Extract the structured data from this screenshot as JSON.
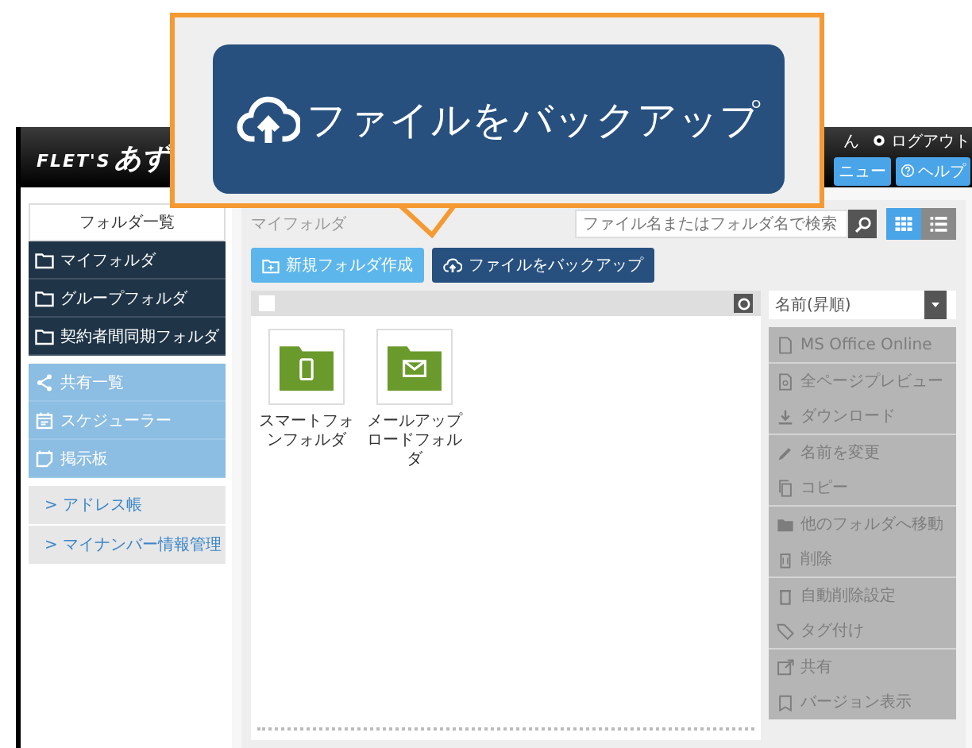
{
  "header": {
    "logo_latin": "FLET'S",
    "logo_kana": "あず",
    "user_suffix": "ん",
    "logout": "ログアウト",
    "menu_button": "ニュー",
    "help_button": "ヘルプ"
  },
  "callout": {
    "label": "ファイルをバックアップ"
  },
  "sidebar": {
    "title": "フォルダ一覧",
    "folders": [
      "マイフォルダ",
      "グループフォルダ",
      "契約者間同期フォルダ"
    ],
    "tools": [
      {
        "label": "共有一覧",
        "kind": "share"
      },
      {
        "label": "スケジューラー",
        "kind": "calendar"
      },
      {
        "label": "掲示板",
        "kind": "board"
      }
    ],
    "links": [
      "> アドレス帳",
      "> マイナンバー情報管理"
    ]
  },
  "breadcrumb": "マイフォルダ",
  "toolbar": {
    "new_folder": "新規フォルダ作成",
    "backup": "ファイルをバックアップ",
    "search": {
      "placeholder": "ファイル名またはフォルダ名で検索"
    },
    "views": [
      {
        "kind": "grid",
        "selected": true
      },
      {
        "kind": "list",
        "selected": false
      }
    ]
  },
  "file_list": {
    "select_all": {
      "checked": false
    },
    "sort": "名前(昇順)",
    "items": [
      {
        "name": "スマートフォンフォルダ",
        "kind": "phone"
      },
      {
        "name": "メールアップロードフォルダ",
        "kind": "mail"
      }
    ]
  },
  "actions": [
    {
      "items": [
        {
          "label": "MS Office Online",
          "kind": "office",
          "disabled": true
        }
      ]
    },
    {
      "items": [
        {
          "label": "全ページプレビュー",
          "kind": "preview",
          "disabled": true
        },
        {
          "label": "ダウンロード",
          "kind": "download",
          "disabled": true
        }
      ]
    },
    {
      "items": [
        {
          "label": "名前を変更",
          "kind": "rename",
          "disabled": true
        },
        {
          "label": "コピー",
          "kind": "copy",
          "disabled": true
        }
      ]
    },
    {
      "items": [
        {
          "label": "他のフォルダへ移動",
          "kind": "move",
          "disabled": true
        },
        {
          "label": "削除",
          "kind": "delete",
          "disabled": true
        }
      ]
    },
    {
      "items": [
        {
          "label": "自動削除設定",
          "kind": "autodelete",
          "disabled": true
        },
        {
          "label": "タグ付け",
          "kind": "tag",
          "disabled": true
        }
      ]
    },
    {
      "items": [
        {
          "label": "共有",
          "kind": "share",
          "disabled": true
        },
        {
          "label": "バージョン表示",
          "kind": "version",
          "disabled": true
        }
      ]
    }
  ]
}
